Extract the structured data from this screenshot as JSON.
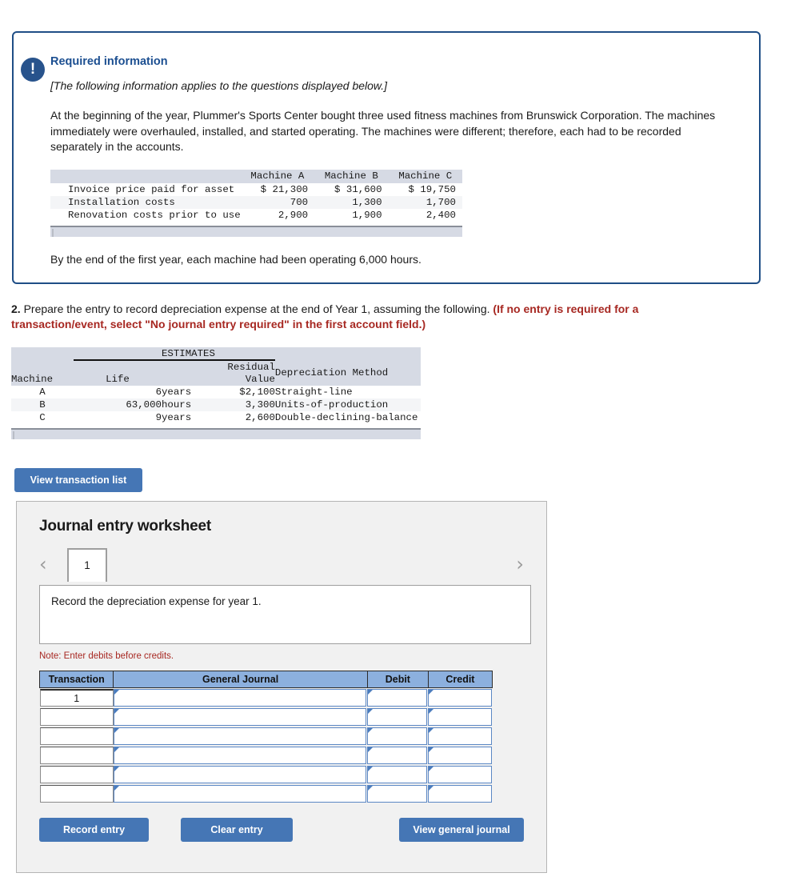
{
  "callout": {
    "icon": "exclamation-icon",
    "title": "Required information",
    "italic_note": "[The following information applies to the questions displayed below.]",
    "paragraph": "At the beginning of the year, Plummer's Sports Center bought three used fitness machines from Brunswick Corporation. The machines immediately were overhauled, installed, and started operating. The machines were different; therefore, each had to be recorded separately in the accounts.",
    "closing": "By the end of the first year, each machine had been operating 6,000 hours."
  },
  "cost_table": {
    "headers": [
      "",
      "Machine A",
      "Machine B",
      "Machine C"
    ],
    "rows": [
      {
        "label": "Invoice price paid for asset",
        "a": "$ 21,300",
        "b": "$ 31,600",
        "c": "$ 19,750"
      },
      {
        "label": "Installation costs",
        "a": "700",
        "b": "1,300",
        "c": "1,700"
      },
      {
        "label": "Renovation costs prior to use",
        "a": "2,900",
        "b": "1,900",
        "c": "2,400"
      }
    ]
  },
  "question": {
    "number": "2.",
    "text": " Prepare the entry to record depreciation expense at the end of Year 1, assuming the following. ",
    "red_text": "(If no entry is required for a transaction/event, select \"No journal entry required\" in the first account field.)"
  },
  "estimates_table": {
    "group_header": "ESTIMATES",
    "headers": {
      "machine": "Machine",
      "life": "Life",
      "residual_line1": "Residual",
      "residual_line2": "Value",
      "method": "Depreciation Method"
    },
    "rows": [
      {
        "machine": "A",
        "life_num": "6",
        "life_unit": "years",
        "residual": "$2,100",
        "method": "Straight-line"
      },
      {
        "machine": "B",
        "life_num": "63,000",
        "life_unit": "hours",
        "residual": "3,300",
        "method": "Units-of-production"
      },
      {
        "machine": "C",
        "life_num": "9",
        "life_unit": "years",
        "residual": "2,600",
        "method": "Double-declining-balance"
      }
    ]
  },
  "buttons": {
    "view_transaction_list": "View transaction list",
    "record_entry": "Record entry",
    "clear_entry": "Clear entry",
    "view_general_journal": "View general journal"
  },
  "worksheet": {
    "title": "Journal entry worksheet",
    "prev_arrow": "‹",
    "next_arrow": "›",
    "active_tab": "1",
    "instruction": "Record the depreciation expense for year 1.",
    "note": "Note: Enter debits before credits.",
    "columns": {
      "transaction": "Transaction",
      "general_journal": "General Journal",
      "debit": "Debit",
      "credit": "Credit"
    },
    "rows": [
      {
        "transaction": "1",
        "general_journal": "",
        "debit": "",
        "credit": ""
      },
      {
        "transaction": "",
        "general_journal": "",
        "debit": "",
        "credit": ""
      },
      {
        "transaction": "",
        "general_journal": "",
        "debit": "",
        "credit": ""
      },
      {
        "transaction": "",
        "general_journal": "",
        "debit": "",
        "credit": ""
      },
      {
        "transaction": "",
        "general_journal": "",
        "debit": "",
        "credit": ""
      },
      {
        "transaction": "",
        "general_journal": "",
        "debit": "",
        "credit": ""
      }
    ]
  },
  "colors": {
    "callout_border": "#1f4e86",
    "callout_title": "#1c4f91",
    "red_emphasis": "#a72822",
    "button_blue": "#4576b5",
    "table_header_blue": "#8cb0de",
    "band_gray": "#d6dae4"
  }
}
